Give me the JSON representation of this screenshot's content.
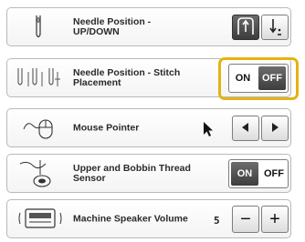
{
  "colors": {
    "highlight": "#e4b313",
    "row_border": "#b9b9b9",
    "active_toggle": "#4a4a4a"
  },
  "rows": [
    {
      "label": "Needle Position - UP/DOWN",
      "icon": "needle-icon",
      "controls": [
        "needle-up-icon",
        "needle-down-icon"
      ]
    },
    {
      "label": "Needle Position - Stitch Placement",
      "icon": "stitch-placement-icon",
      "on_label": "ON",
      "off_label": "OFF",
      "selected": "OFF"
    },
    {
      "label": "Mouse Pointer",
      "icon": "mouse-icon",
      "pointer_icon": "arrow-cursor-icon",
      "prev_icon": "triangle-left-icon",
      "next_icon": "triangle-right-icon"
    },
    {
      "label": "Upper and Bobbin Thread Sensor",
      "icon": "thread-sensor-icon",
      "on_label": "ON",
      "off_label": "OFF",
      "selected": "ON"
    },
    {
      "label": "Machine Speaker Volume",
      "icon": "speaker-icon",
      "value": "5",
      "minus_label": "−",
      "plus_label": "+"
    }
  ]
}
